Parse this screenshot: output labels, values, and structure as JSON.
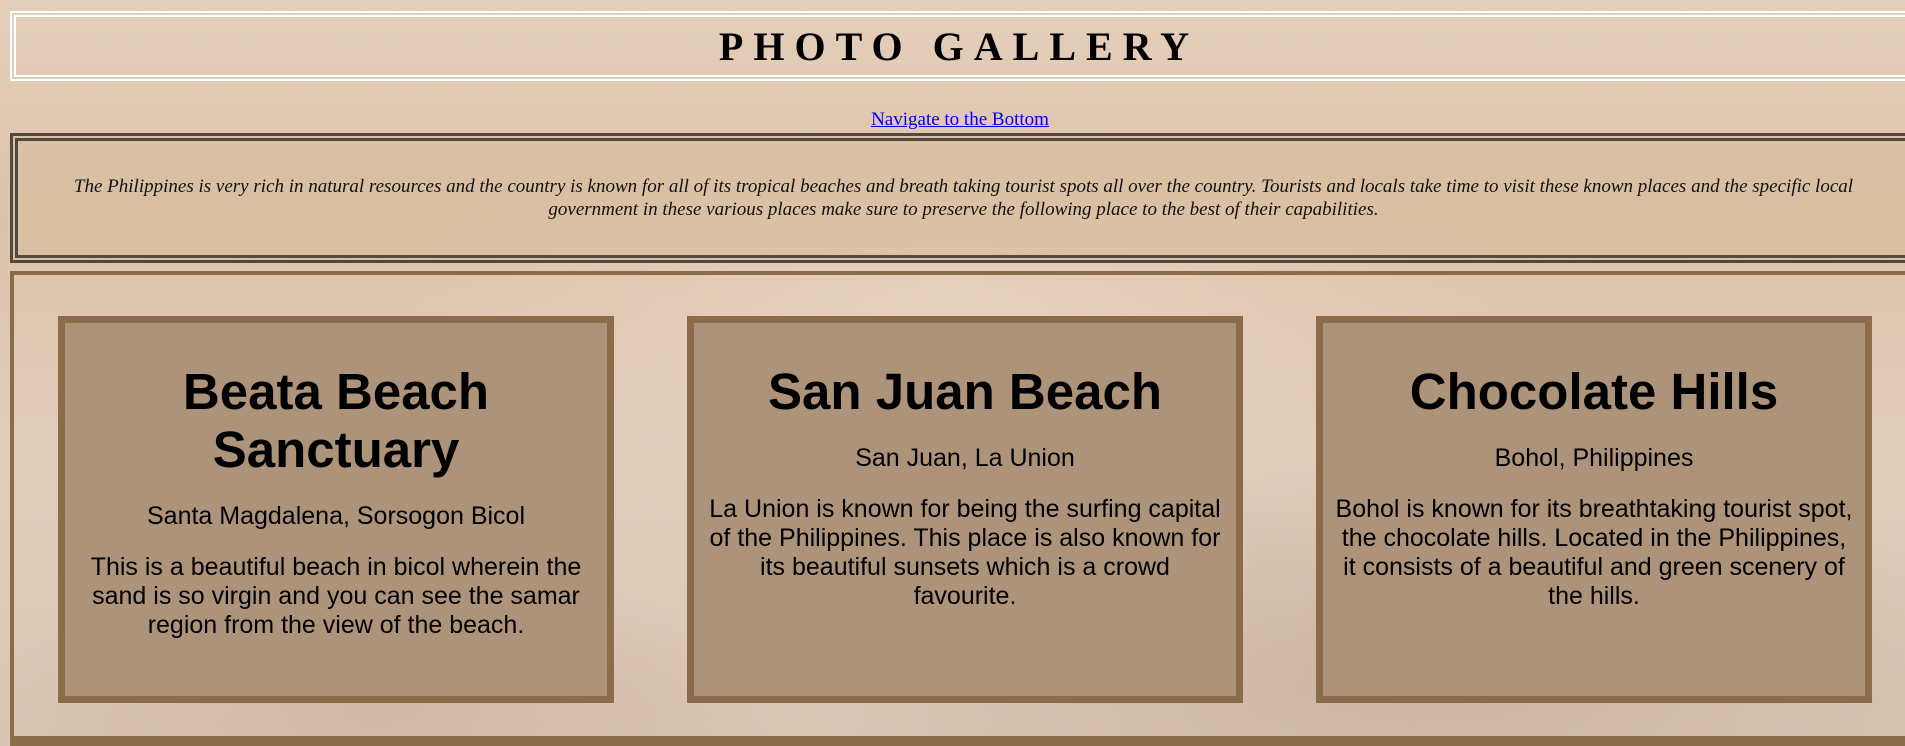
{
  "header": {
    "title": "PHOTO GALLERY"
  },
  "nav": {
    "bottom_link": "Navigate to the Bottom"
  },
  "intro": {
    "text": "The Philippines is very rich in natural resources and the country is known for all of its tropical beaches and breath taking tourist spots all over the country. Tourists and locals take time to visit these known places and the specific local government in these various places make sure to preserve the following place to the best of their capabilities."
  },
  "cards": [
    {
      "title": "Beata Beach Sanctuary",
      "location": "Santa Magdalena, Sorsogon Bicol",
      "description": "This is a beautiful beach in bicol wherein the sand is so virgin and you can see the samar region from the view of the beach."
    },
    {
      "title": "San Juan Beach",
      "location": "San Juan, La Union",
      "description": "La Union is known for being the surfing capital of the Philippines. This place is also known for its beautiful sunsets which is a crowd favourite."
    },
    {
      "title": "Chocolate Hills",
      "location": "Bohol, Philippines",
      "description": "Bohol is known for its breathtaking tourist spot, the chocolate hills. Located in the Philippines, it consists of a beautiful and green scenery of the hills."
    }
  ]
}
